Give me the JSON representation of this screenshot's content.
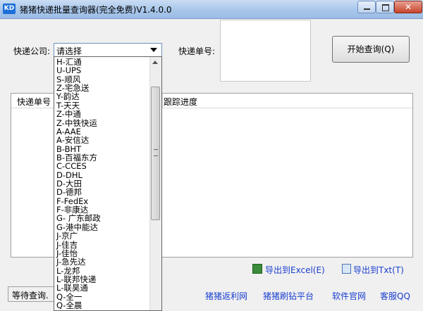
{
  "window": {
    "icon_text": "KD",
    "title": "猪猪快递批量查询器(完全免费)V1.4.0.0",
    "close_glyph": "✕"
  },
  "form": {
    "company_label": "快递公司:",
    "company_value": "请选择",
    "tracking_label": "快递单号:",
    "query_button": "开始查询(Q)"
  },
  "results": {
    "columns": [
      "快递单号",
      "跟踪进度"
    ]
  },
  "dropdown": {
    "options": [
      "H-汇通",
      "U-UPS",
      "S-顺风",
      "Z-宅急送",
      "Y-韵达",
      "T-天天",
      "Z-中通",
      "Z-中铁快运",
      "A-AAE",
      "A-安信达",
      "B-BHT",
      "B-百福东方",
      "C-CCES",
      "D-DHL",
      "D-大田",
      "D-德邦",
      "F-FedEx",
      "F-非康达",
      "G- 广东邮政",
      "G-港中能达",
      "J-京广",
      "J-佳吉",
      "J-佳怡",
      "J-急先达",
      "L-龙邦",
      "L-联邦快递",
      "L-联昊通",
      "Q-全一",
      "Q-全晨"
    ]
  },
  "export": {
    "excel": "导出到Excel(E)",
    "txt": "导出到Txt(T)"
  },
  "status": {
    "text": "等待查询."
  },
  "links": {
    "rebate": "猪猪返利网",
    "diamond": "猪猪刷钻平台",
    "official": "软件官网",
    "support": "客服QQ"
  }
}
